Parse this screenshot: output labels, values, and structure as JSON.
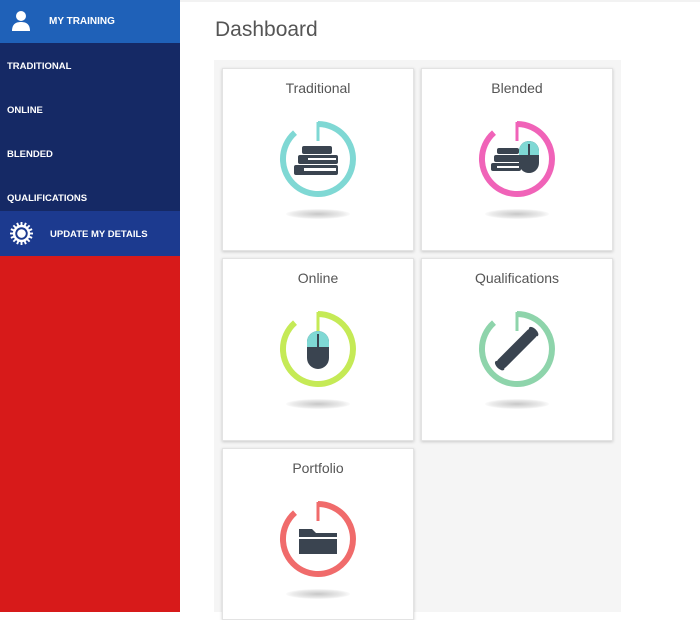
{
  "sidebar": {
    "header_label": "MY TRAINING",
    "items": [
      {
        "label": "TRADITIONAL"
      },
      {
        "label": "ONLINE"
      },
      {
        "label": "BLENDED"
      },
      {
        "label": "QUALIFICATIONS"
      }
    ],
    "update_label": "UPDATE MY DETAILS"
  },
  "main": {
    "title": "Dashboard",
    "cards": [
      {
        "title": "Traditional",
        "icon": "books-icon",
        "ring_color": "#7fd8d4"
      },
      {
        "title": "Blended",
        "icon": "books-mouse-icon",
        "ring_color": "#f063b8"
      },
      {
        "title": "Online",
        "icon": "mouse-icon",
        "ring_color": "#c5ea56"
      },
      {
        "title": "Qualifications",
        "icon": "diploma-icon",
        "ring_color": "#8ed4ab"
      },
      {
        "title": "Portfolio",
        "icon": "folder-icon",
        "ring_color": "#f06b6b"
      }
    ]
  },
  "colors": {
    "sidebar_bg": "#d71a1a",
    "sidebar_header": "#1f61b8",
    "sidebar_menu": "#152965",
    "update_bg": "#1c3a8f",
    "icon_dark": "#3a4450"
  }
}
